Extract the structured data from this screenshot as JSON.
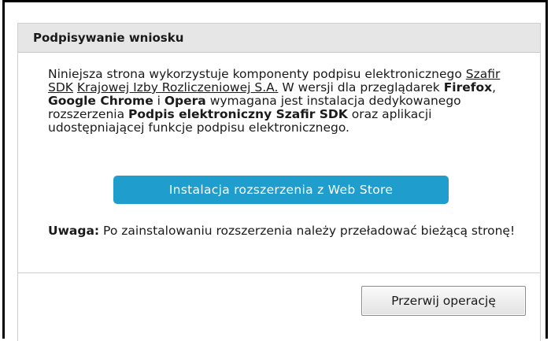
{
  "dialog": {
    "title": "Podpisywanie wniosku",
    "intro": {
      "t1": "Niniejsza strona wykorzystuje komponenty podpisu elektronicznego ",
      "link1": "Szafir SDK",
      "t2": " ",
      "link2": "Krajowej Izby Rozliczeniowej S.A.",
      "t3": " W wersji dla przeglądarek ",
      "b1": "Firefox",
      "t4": ", ",
      "b2": "Google Chrome",
      "t5": " i ",
      "b3": "Opera",
      "t6": " wymagana jest instalacja dedykowanego rozszerzenia ",
      "b4": "Podpis elektroniczny Szafir SDK",
      "t7": " oraz aplikacji udostępniającej funkcje podpisu elektronicznego."
    },
    "install_button": "Instalacja rozszerzenia z Web Store",
    "note": {
      "label": "Uwaga:",
      "text": " Po zainstalowaniu rozszerzenia należy przeładować bieżącą stronę!"
    },
    "cancel_button": "Przerwij operację"
  },
  "colors": {
    "install_button_bg": "#1f9dcc",
    "titlebar_bg": "#e6e6e6"
  }
}
